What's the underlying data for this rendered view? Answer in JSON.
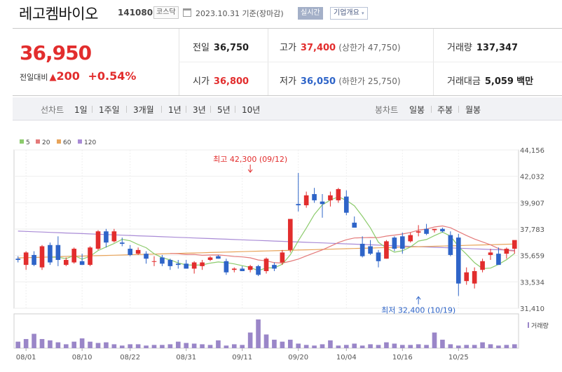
{
  "header": {
    "name": "레고켐바이오",
    "code": "141080",
    "market": "코스닥",
    "date": "2023.10.31 기준(장마감)",
    "realtime": "실시간",
    "corp_info": "기업개요",
    "dropdown_glyph": "▾"
  },
  "quote": {
    "price": "36,950",
    "change_label": "전일대비",
    "change_symbol": "▲",
    "change_value": "200",
    "change_pct": "+0.54%",
    "prev_close_label": "전일",
    "prev_close": "36,750",
    "high_label": "고가",
    "high": "37,400",
    "upper_limit": "(상한가 47,750)",
    "volume_label": "거래량",
    "volume": "137,347",
    "open_label": "시가",
    "open": "36,800",
    "low_label": "저가",
    "low": "36,050",
    "lower_limit": "(하한가 25,750)",
    "value_label": "거래대금",
    "value": "5,059",
    "value_unit": "백만"
  },
  "toolbar": {
    "line_chart_label": "선차트",
    "periods": [
      "1일",
      "1주일",
      "3개월",
      "1년",
      "3년",
      "5년",
      "10년"
    ],
    "candle_label": "봉차트",
    "candle_types": [
      "일봉",
      "주봉",
      "월봉"
    ],
    "selected_candle": "일봉"
  },
  "colors": {
    "up": "#e22d2d",
    "down": "#2e64c8",
    "ma5": "#8ccb6c",
    "ma20": "#e47a7a",
    "ma60": "#e8a45a",
    "ma120": "#a98bd6",
    "volume": "#9a86c8"
  },
  "chart_data": {
    "type": "candlestick",
    "y_ticks": [
      "44,156",
      "42,032",
      "39,907",
      "37,783",
      "35,659",
      "33,534",
      "31,410"
    ],
    "ylim": [
      31410,
      44156
    ],
    "x_ticks": [
      "08/01",
      "08/10",
      "08/22",
      "08/31",
      "09/11",
      "09/20",
      "10/04",
      "10/16",
      "10/25"
    ],
    "x_tick_index": [
      1,
      8,
      14,
      21,
      28,
      35,
      41,
      48,
      55
    ],
    "legend": [
      {
        "name": "5",
        "color": "#8ccb6c"
      },
      {
        "name": "20",
        "color": "#e47a7a"
      },
      {
        "name": "60",
        "color": "#e8a45a"
      },
      {
        "name": "120",
        "color": "#a98bd6"
      }
    ],
    "annotations": {
      "high": {
        "label": "최고 42,300 (09/12)",
        "value": 42300,
        "index": 29
      },
      "low": {
        "label": "최저 32,400 (10/19)",
        "value": 32400,
        "index": 50
      }
    },
    "volume_label": "거래량",
    "candles": [
      [
        35400,
        35600,
        35100,
        35300
      ],
      [
        34900,
        36000,
        34500,
        35900
      ],
      [
        35700,
        36000,
        34800,
        34900
      ],
      [
        34700,
        36500,
        34500,
        36400
      ],
      [
        36500,
        36700,
        34900,
        35100
      ],
      [
        36500,
        37200,
        34800,
        35300
      ],
      [
        34900,
        35500,
        34800,
        35300
      ],
      [
        35100,
        36300,
        35000,
        36200
      ],
      [
        35200,
        35800,
        34900,
        34900
      ],
      [
        34900,
        36400,
        34800,
        36300
      ],
      [
        36200,
        37700,
        36100,
        37600
      ],
      [
        37600,
        37800,
        36300,
        36700
      ],
      [
        36800,
        37800,
        36700,
        37600
      ],
      [
        36700,
        37100,
        36400,
        36600
      ],
      [
        36200,
        36500,
        35600,
        35700
      ],
      [
        35800,
        36300,
        35700,
        36100
      ],
      [
        35800,
        36000,
        35000,
        35400
      ],
      [
        35200,
        35600,
        34800,
        35200
      ],
      [
        35500,
        35700,
        34800,
        35000
      ],
      [
        35300,
        35400,
        34500,
        34800
      ],
      [
        35000,
        35300,
        34600,
        34900
      ],
      [
        35000,
        35300,
        34600,
        34600
      ],
      [
        34600,
        35200,
        34200,
        35100
      ],
      [
        34800,
        35300,
        34500,
        35100
      ],
      [
        35300,
        35600,
        35200,
        35500
      ],
      [
        35600,
        35700,
        35400,
        35400
      ],
      [
        35200,
        35400,
        34100,
        34300
      ],
      [
        34500,
        34700,
        34300,
        34600
      ],
      [
        34600,
        34800,
        34500,
        34400
      ],
      [
        34500,
        34900,
        34300,
        34800
      ],
      [
        34800,
        34900,
        34000,
        34100
      ],
      [
        34400,
        35500,
        34200,
        35400
      ],
      [
        34900,
        35100,
        34400,
        34600
      ],
      [
        35100,
        36100,
        34900,
        35900
      ],
      [
        36100,
        38600,
        35900,
        38600
      ],
      [
        39800,
        42300,
        39200,
        39700
      ],
      [
        39700,
        40800,
        39500,
        40500
      ],
      [
        40600,
        41100,
        39900,
        40100
      ],
      [
        40000,
        40600,
        38700,
        39800
      ],
      [
        40100,
        40800,
        39600,
        40500
      ],
      [
        40100,
        41100,
        39900,
        41000
      ],
      [
        40400,
        40900,
        38900,
        39100
      ],
      [
        38300,
        38800,
        37900,
        37900
      ],
      [
        36600,
        37200,
        35500,
        35600
      ],
      [
        36400,
        36900,
        35700,
        35800
      ],
      [
        35900,
        36100,
        34700,
        35200
      ],
      [
        35400,
        36900,
        35400,
        36800
      ],
      [
        37100,
        37200,
        36000,
        36200
      ],
      [
        37200,
        37500,
        35800,
        36200
      ],
      [
        36800,
        37500,
        36700,
        37300
      ],
      [
        37500,
        38100,
        37200,
        37600
      ],
      [
        37800,
        38200,
        37300,
        37400
      ],
      [
        37700,
        37800,
        37500,
        37800
      ],
      [
        37800,
        37900,
        37500,
        37600
      ],
      [
        37300,
        37600,
        35600,
        35700
      ],
      [
        37100,
        37400,
        32400,
        33400
      ],
      [
        33600,
        34700,
        33300,
        34300
      ],
      [
        33400,
        34700,
        33000,
        34400
      ],
      [
        34500,
        35400,
        34300,
        35200
      ],
      [
        35700,
        36200,
        35300,
        35900
      ],
      [
        35800,
        36300,
        34900,
        34900
      ],
      [
        35800,
        36300,
        35400,
        36200
      ],
      [
        36200,
        36800,
        35800,
        36900
      ]
    ],
    "volumes": [
      1.0,
      1.4,
      2.2,
      1.4,
      1.2,
      0.9,
      0.6,
      1.0,
      1.5,
      1.0,
      0.8,
      0.9,
      0.6,
      0.4,
      0.6,
      0.6,
      0.4,
      0.5,
      0.5,
      0.6,
      1.0,
      0.8,
      0.7,
      0.6,
      0.5,
      1.2,
      0.4,
      0.6,
      0.5,
      2.4,
      4.4,
      2.1,
      1.3,
      1.0,
      1.3,
      0.7,
      0.5,
      0.4,
      0.6,
      1.2,
      0.4,
      0.5,
      0.7,
      0.4,
      0.6,
      0.5,
      0.9,
      0.7,
      0.5,
      0.5,
      0.6,
      0.5,
      2.4,
      1.3,
      0.6,
      0.4,
      0.5,
      0.5,
      0.9,
      0.6,
      0.4,
      0.5,
      0.6
    ]
  }
}
